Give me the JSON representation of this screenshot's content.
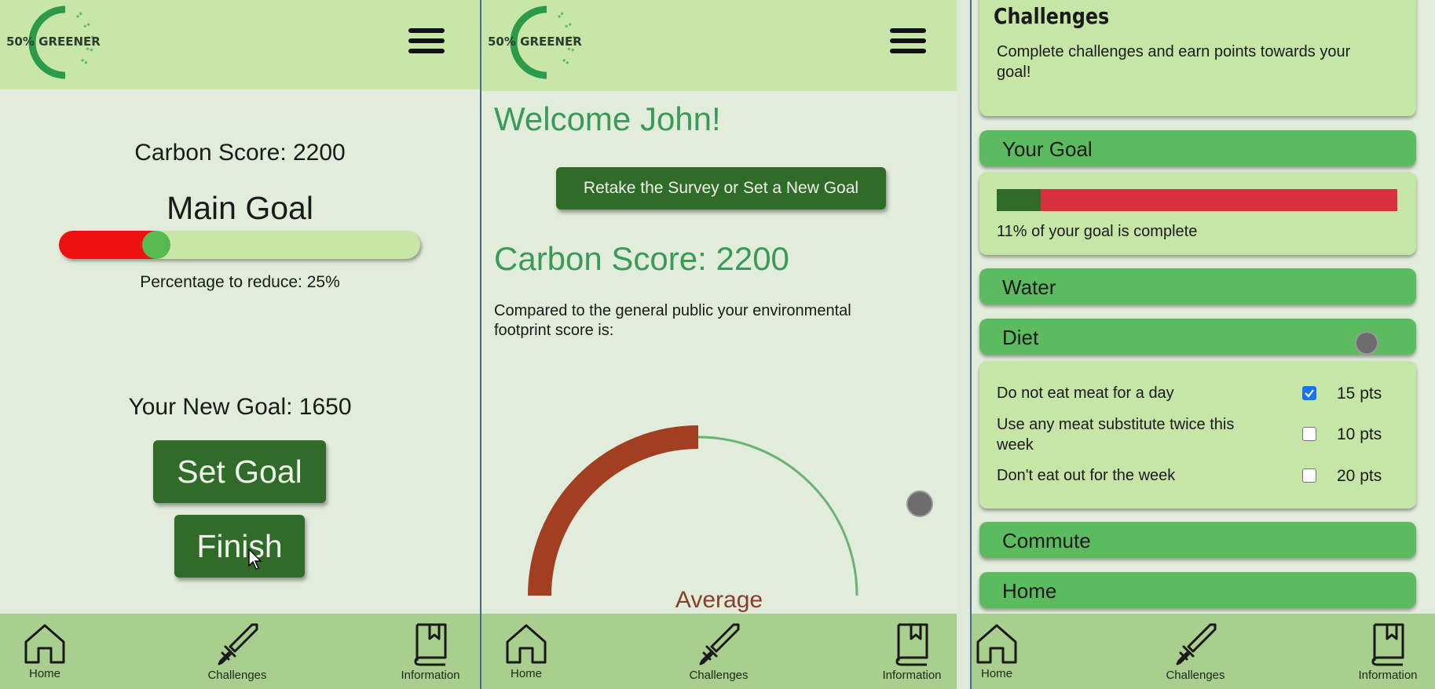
{
  "app": {
    "logo_text": "50% GREENER"
  },
  "nav": {
    "home": "Home",
    "challenges": "Challenges",
    "information": "Information"
  },
  "screen1": {
    "carbon_score": "Carbon Score: 2200",
    "main_goal": "Main Goal",
    "goal_slider_value": 0.27,
    "percentage_text": "Percentage to reduce: 25%",
    "new_goal": "Your New Goal: 1650",
    "set_goal_button": "Set Goal",
    "finish_button": "Finish"
  },
  "screen2": {
    "welcome": "Welcome John!",
    "retake_button": "Retake the Survey or Set a New Goal",
    "carbon_score": "Carbon Score: 2200",
    "compare_text": "Compared to the general public your environmental footprint score is:",
    "gauge_label": "Average"
  },
  "screen3": {
    "title": "Challenges",
    "intro": "Complete challenges and earn points towards your goal!",
    "your_goal": "Your Goal",
    "goal_progress": 0.11,
    "goal_complete_text": "11% of your goal is complete",
    "categories": {
      "water": "Water",
      "diet": "Diet",
      "commute": "Commute",
      "home": "Home"
    },
    "diet_challenges": [
      {
        "text": "Do not eat meat for a day",
        "checked": true,
        "points": "15 pts"
      },
      {
        "text": "Use any meat substitute twice this week",
        "checked": false,
        "points": "10 pts"
      },
      {
        "text": "Don't eat out for the week",
        "checked": false,
        "points": "20 pts"
      }
    ]
  },
  "colors": {
    "header": "#c7e6a8",
    "nav": "#a9cf8f",
    "button": "#316b29",
    "accordion": "#5cba5f",
    "progress_done": "#2e6a28",
    "progress_remaining": "#d9303f",
    "gauge_fill": "#a23f23",
    "gauge_track": "#6bb277",
    "heading_green": "#3a9a58"
  }
}
